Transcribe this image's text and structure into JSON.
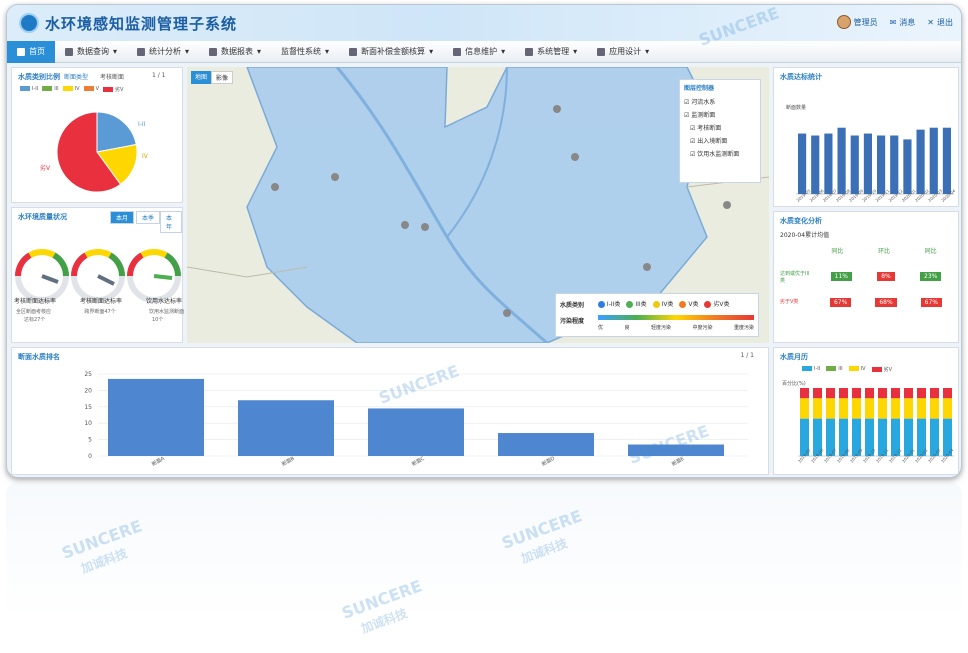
{
  "header": {
    "title": "水环境感知监测管理子系统",
    "user": "管理员",
    "messages": "消息",
    "logout": "退出"
  },
  "nav": [
    {
      "label": "首页"
    },
    {
      "label": "数据查询"
    },
    {
      "label": "统计分析"
    },
    {
      "label": "数据报表"
    },
    {
      "label": "监督性系统"
    },
    {
      "label": "断面补偿金额核算"
    },
    {
      "label": "信息维护"
    },
    {
      "label": "系统管理"
    },
    {
      "label": "应用设计"
    }
  ],
  "ratio_panel": {
    "title": "水质类别比例",
    "tab_a": "断面类型",
    "tab_b": "考核断面",
    "pager": "1 / 1",
    "legend": [
      "I-II",
      "III",
      "IV",
      "V",
      "劣V"
    ],
    "pie_labels": [
      "劣V",
      "I-II",
      "IV"
    ],
    "colors": [
      "#5b9bd5",
      "#70ad47",
      "#ffd700",
      "#ed7d31",
      "#e8303f"
    ]
  },
  "chart_data": [
    {
      "type": "pie",
      "title": "水质类别比例",
      "labels": [
        "I-II",
        "III",
        "IV",
        "V",
        "劣V"
      ],
      "values": [
        22,
        0,
        18,
        0,
        60
      ]
    },
    {
      "type": "bar",
      "title": "水质达标统计",
      "ylabel": "断面数量",
      "categories": [
        "2019-05",
        "2019-06",
        "2019-07",
        "2019-08",
        "2019-09",
        "2019-10",
        "2019-11",
        "2019-12",
        "2020-01",
        "2020-02",
        "2020-03",
        "2020-04"
      ],
      "values": [
        62,
        60,
        62,
        68,
        60,
        62,
        60,
        60,
        56,
        66,
        68,
        68
      ],
      "ylim": [
        0,
        80
      ]
    },
    {
      "type": "bar",
      "title": "断面水质排名",
      "categories": [
        "断面A",
        "断面B",
        "断面C",
        "断面D",
        "断面E"
      ],
      "values": [
        23.5,
        17,
        14.5,
        7,
        3.5
      ],
      "ylim": [
        0,
        25
      ]
    }
  ],
  "status_panel": {
    "title": "水环境质量状况",
    "tabs": [
      "本月",
      "本季",
      "本年"
    ],
    "gauges": [
      {
        "label": "考核断面达标率",
        "sub": "全区断面考核应",
        "sub2": "达标27个"
      },
      {
        "label": "考核断面达标率",
        "sub": "跨界断面47个",
        "sub2": ""
      },
      {
        "label": "饮用水达标率",
        "sub": "饮用水监测断面",
        "sub2": "10个"
      }
    ]
  },
  "map": {
    "tabs": [
      "地图",
      "影像"
    ],
    "control_title": "图层控制器",
    "layers": [
      "河流水系",
      "监测断面",
      "考核断面",
      "出入境断面",
      "饮用水监测断面"
    ],
    "legend_title": "水质类别",
    "legend_items": [
      "I-II类",
      "III类",
      "IV类",
      "V类",
      "劣V类"
    ],
    "legend_colors": [
      "#2f7de1",
      "#4caf50",
      "#f2c811",
      "#f07a22",
      "#e53935"
    ],
    "pollution_title": "污染程度",
    "pollution_levels": [
      "优",
      "良",
      "轻度污染",
      "中度污染",
      "重度污染"
    ]
  },
  "reach_panel": {
    "title": "水质达标统计",
    "ylabel": "断面数量"
  },
  "change_panel": {
    "title": "水质变化分析",
    "subtitle": "2020-04累计均值",
    "cols": [
      "同比",
      "环比",
      "同比"
    ],
    "rows": [
      {
        "label": "达到或优于III类",
        "vals": [
          "11%",
          "8%",
          "23%"
        ],
        "colors": [
          "#43a047",
          "#e53935",
          "#43a047"
        ]
      },
      {
        "label": "劣于V类",
        "vals": [
          "67%",
          "68%",
          "67%"
        ],
        "colors": [
          "#e53935",
          "#e53935",
          "#e53935"
        ]
      }
    ]
  },
  "rank_panel": {
    "title": "断面水质排名",
    "pager": "1 / 1",
    "yticks": [
      "25",
      "20",
      "15",
      "10",
      "5",
      "0"
    ]
  },
  "trend_panel": {
    "title": "水质月历",
    "legend": [
      "I-II",
      "III",
      "IV",
      "劣V"
    ],
    "ylabel": "百分比(%)"
  },
  "watermark": {
    "brand": "SUNCERE",
    "sub": "加诚科技"
  }
}
